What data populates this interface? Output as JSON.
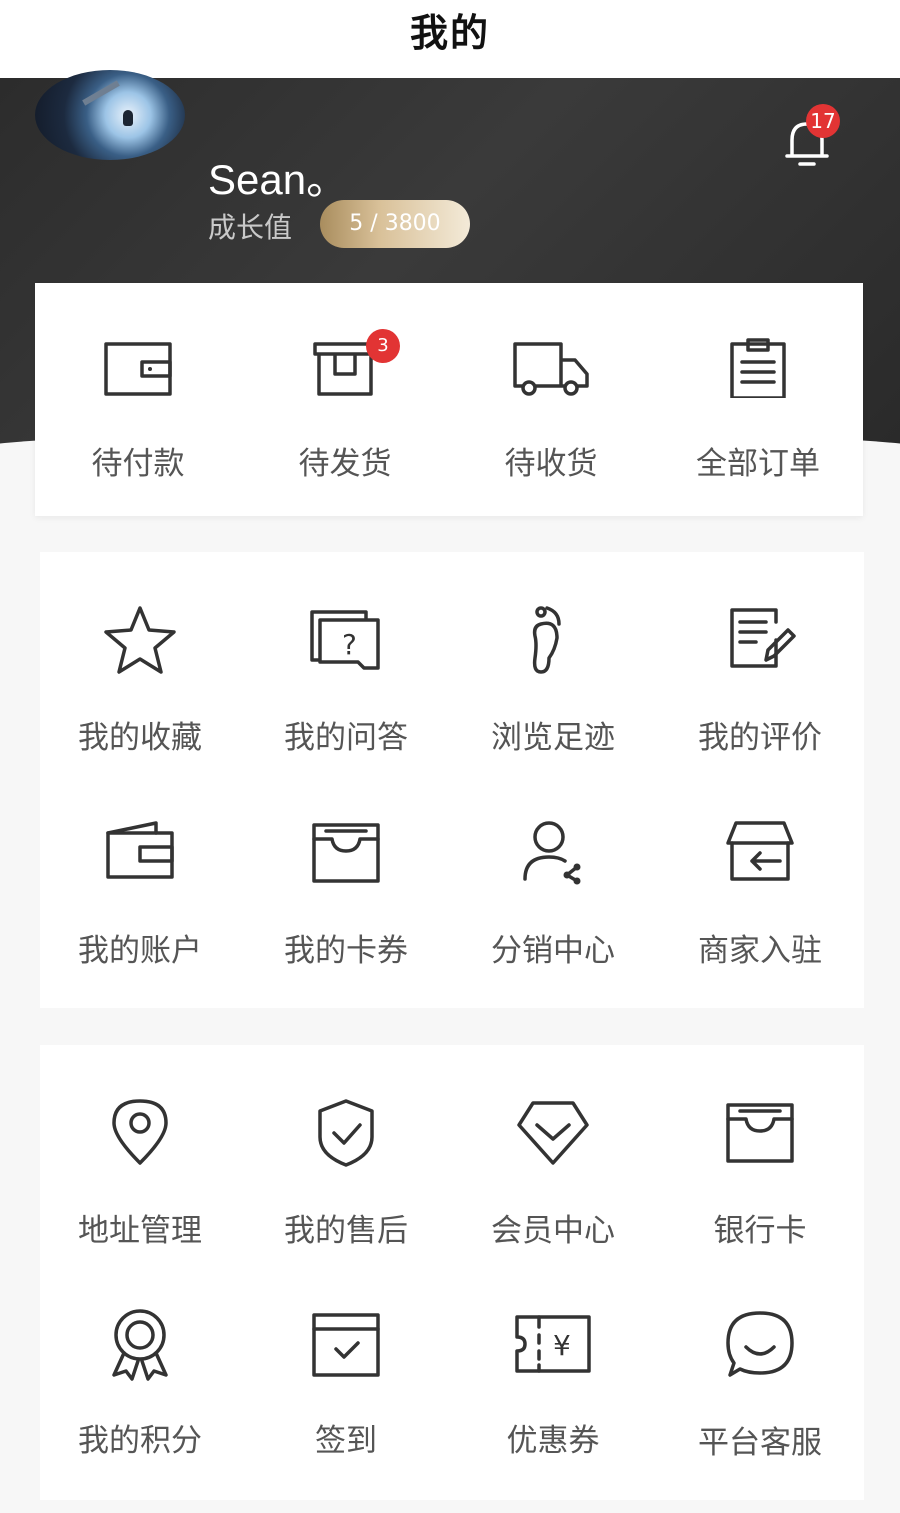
{
  "header": {
    "title": "我的"
  },
  "profile": {
    "username": "Sean。",
    "growth_label": "成长值",
    "growth_value": "5 / 3800",
    "notification_count": "17"
  },
  "orders": [
    {
      "label": "待付款",
      "icon": "wallet-icon"
    },
    {
      "label": "待发货",
      "icon": "box-icon",
      "badge": "3"
    },
    {
      "label": "待收货",
      "icon": "truck-icon"
    },
    {
      "label": "全部订单",
      "icon": "clipboard-icon"
    }
  ],
  "tools": [
    {
      "label": "我的收藏",
      "icon": "star-icon"
    },
    {
      "label": "我的问答",
      "icon": "question-icon"
    },
    {
      "label": "浏览足迹",
      "icon": "footprint-icon"
    },
    {
      "label": "我的评价",
      "icon": "review-icon"
    },
    {
      "label": "我的账户",
      "icon": "account-wallet-icon"
    },
    {
      "label": "我的卡券",
      "icon": "card-voucher-icon"
    },
    {
      "label": "分销中心",
      "icon": "share-user-icon"
    },
    {
      "label": "商家入驻",
      "icon": "store-enter-icon"
    }
  ],
  "service": [
    {
      "label": "地址管理",
      "icon": "location-icon"
    },
    {
      "label": "我的售后",
      "icon": "shield-check-icon"
    },
    {
      "label": "会员中心",
      "icon": "diamond-icon"
    },
    {
      "label": "银行卡",
      "icon": "bank-card-icon"
    },
    {
      "label": "我的积分",
      "icon": "medal-icon"
    },
    {
      "label": "签到",
      "icon": "checkin-icon"
    },
    {
      "label": "优惠券",
      "icon": "coupon-icon"
    },
    {
      "label": "平台客服",
      "icon": "chat-icon"
    }
  ]
}
